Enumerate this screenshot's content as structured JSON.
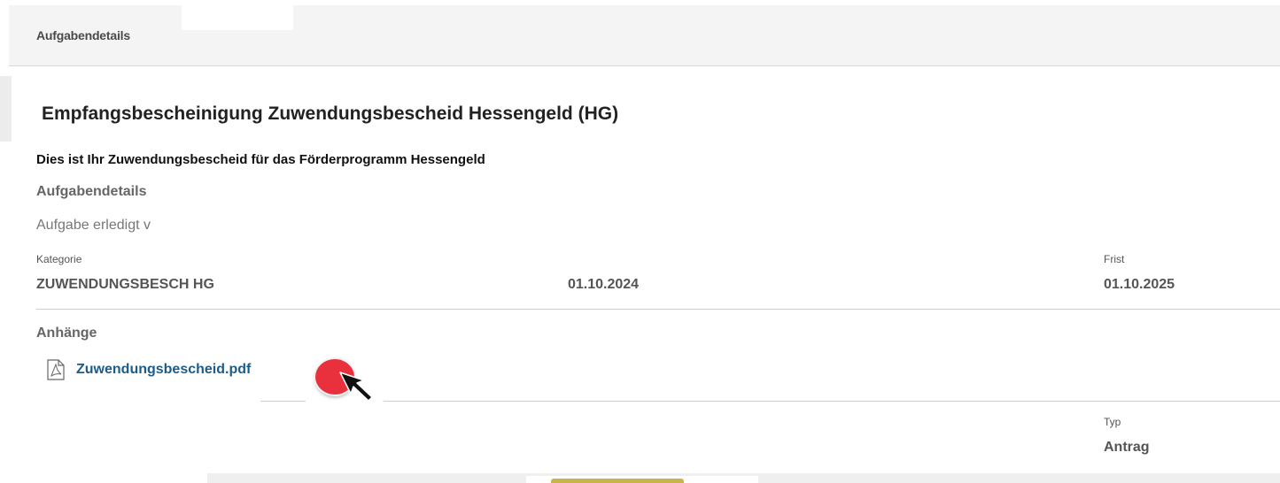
{
  "header": {
    "title": "Aufgabendetails"
  },
  "task": {
    "title": "Empfangsbescheinigung Zuwendungsbescheid Hessengeld (HG)",
    "description": "Dies ist Ihr Zuwendungsbescheid für das Förderprogramm Hessengeld",
    "details_heading": "Aufgabendetails",
    "status": "Aufgabe erledigt v"
  },
  "fields": {
    "category_label": "Kategorie",
    "category_value": "ZUWENDUNGSBESCH HG",
    "date_value": "01.10.2024",
    "deadline_label": "Frist",
    "deadline_value": "01.10.2025",
    "type_label": "Typ",
    "type_value": "Antrag"
  },
  "attachments": {
    "heading": "Anhänge",
    "items": [
      {
        "name": "Zuwendungsbescheid.pdf",
        "icon": "pdf-icon"
      }
    ]
  },
  "colors": {
    "link": "#1a5c8a",
    "click_marker": "#e8313d"
  }
}
